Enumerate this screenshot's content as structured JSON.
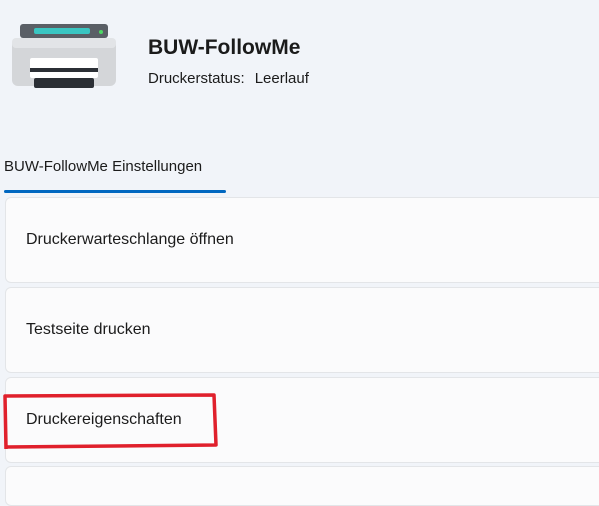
{
  "header": {
    "icon": "printer-icon",
    "title": "BUW-FollowMe",
    "status_label": "Druckerstatus:",
    "status_value": "Leerlauf"
  },
  "tab": {
    "label": "BUW-FollowMe Einstellungen",
    "accent_color": "#0067c0"
  },
  "actions": [
    {
      "label": "Druckerwarteschlange öffnen"
    },
    {
      "label": "Testseite drucken"
    },
    {
      "label": "Druckereigenschaften"
    },
    {
      "label": ""
    }
  ],
  "annotation": {
    "type": "red-hand-drawn-box",
    "target": "Druckereigenschaften",
    "color": "#e0202c"
  }
}
